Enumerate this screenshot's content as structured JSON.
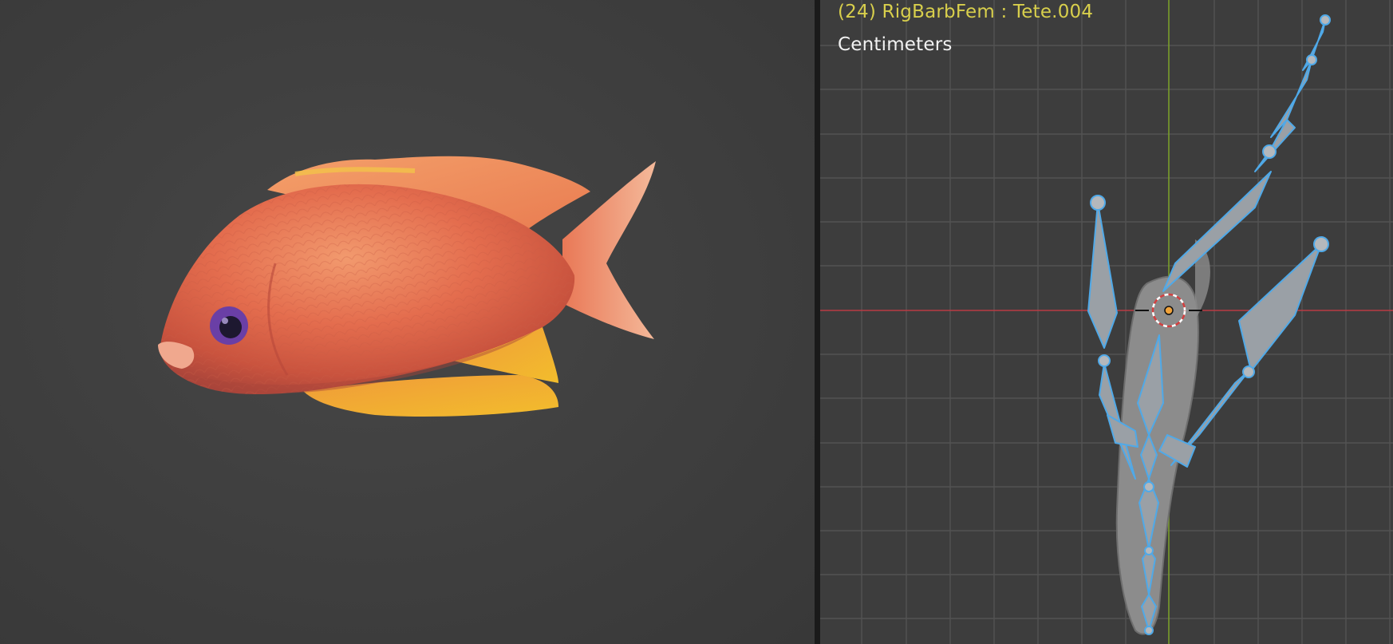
{
  "left_viewport": {
    "subject": "fish-model",
    "shading": "material-preview"
  },
  "right_viewport": {
    "object_info": "(24) RigBarbFem : Tete.004",
    "unit_label": "Centimeters",
    "colors": {
      "background": "#3d3d3d",
      "grid": "#535353",
      "x_axis": "#b93b45",
      "y_axis": "#7a9e2a",
      "bone_outline": "#4fa9e8",
      "bone_fill": "#9aa0a6",
      "object_info_text": "#d8cf4c"
    }
  }
}
